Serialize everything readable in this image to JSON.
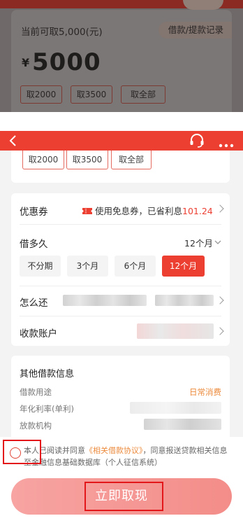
{
  "top_section": {
    "available_text": "当前可取5,000(元)",
    "record_button": "借款/提款记录",
    "currency_symbol": "¥",
    "amount": "5000",
    "quick_amounts": [
      "取2000",
      "取3500",
      "取全部"
    ]
  },
  "repeated_quick_amounts": [
    "取2000",
    "取3500",
    "取全部"
  ],
  "header": {
    "icons": [
      "back-arrow",
      "headset-support",
      "more-dots"
    ],
    "accent_color": "#ec3f32"
  },
  "coupon": {
    "label": "优惠券",
    "value_prefix": "使用免息券，已省利息",
    "saved_amount": "101.24",
    "icon": "ticket"
  },
  "loan_term": {
    "label": "借多久",
    "selected_value": "12个月",
    "options": [
      "不分期",
      "3个月",
      "6个月",
      "12个月"
    ],
    "selected_index": 3
  },
  "repay": {
    "label": "怎么还"
  },
  "account": {
    "label": "收款账户"
  },
  "other_info": {
    "title": "其他借款信息",
    "purpose_label": "借款用途",
    "purpose_value": "日常消费",
    "rate_label": "年化利率(单利)",
    "institution_label": "放款机构"
  },
  "agreement": {
    "text_prefix": "本人已阅读并同意",
    "link_text": "《相关借款协议》",
    "text_suffix": "，同意报送贷款相关信息至金融信息基础数据库（个人征信系统）"
  },
  "cta": {
    "label": "立即取现"
  }
}
